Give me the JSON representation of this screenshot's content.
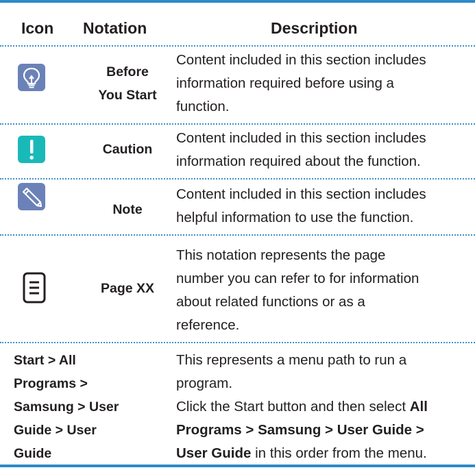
{
  "header": {
    "icon": "Icon",
    "notation": "Notation",
    "description": "Description"
  },
  "rows": [
    {
      "icon": "lightbulb-icon",
      "icon_color": "#6b82b8",
      "notation_line1": "Before",
      "notation_line2": "You Start",
      "desc_line1": "Content included in this section includes",
      "desc_line2": "information required before using a",
      "desc_line3": "function."
    },
    {
      "icon": "exclamation-icon",
      "icon_color": "#1ab9b9",
      "notation": "Caution",
      "desc_line1": "Content included in this section includes",
      "desc_line2": "information required about the function."
    },
    {
      "icon": "pencil-icon",
      "icon_color": "#6b82b8",
      "notation": "Note",
      "desc_line1": "Content included in this section includes",
      "desc_line2": "helpful information to use the function."
    },
    {
      "icon": "page-reference-icon",
      "notation": "Page XX",
      "desc_line1": "This notation represents the page",
      "desc_line2": "number you can refer to for information",
      "desc_line3": "about related functions or as a",
      "desc_line4": "reference."
    },
    {
      "notation_line1": "Start > All",
      "notation_line2": "Programs >",
      "notation_line3": "Samsung > User",
      "notation_line4": "Guide > User",
      "notation_line5": "Guide",
      "desc_line1": "This represents a menu path to run a",
      "desc_line2": "program.",
      "desc_line3_plain": "Click the Start button and then select ",
      "desc_line3_bold": "All",
      "desc_line4_bold": "Programs > Samsung > User Guide >",
      "desc_line5_bold": "User Guide",
      "desc_line5_plain": " in this order from the menu."
    }
  ],
  "colors": {
    "rule": "#2f8ac9",
    "dotted": "#3c90c9"
  }
}
